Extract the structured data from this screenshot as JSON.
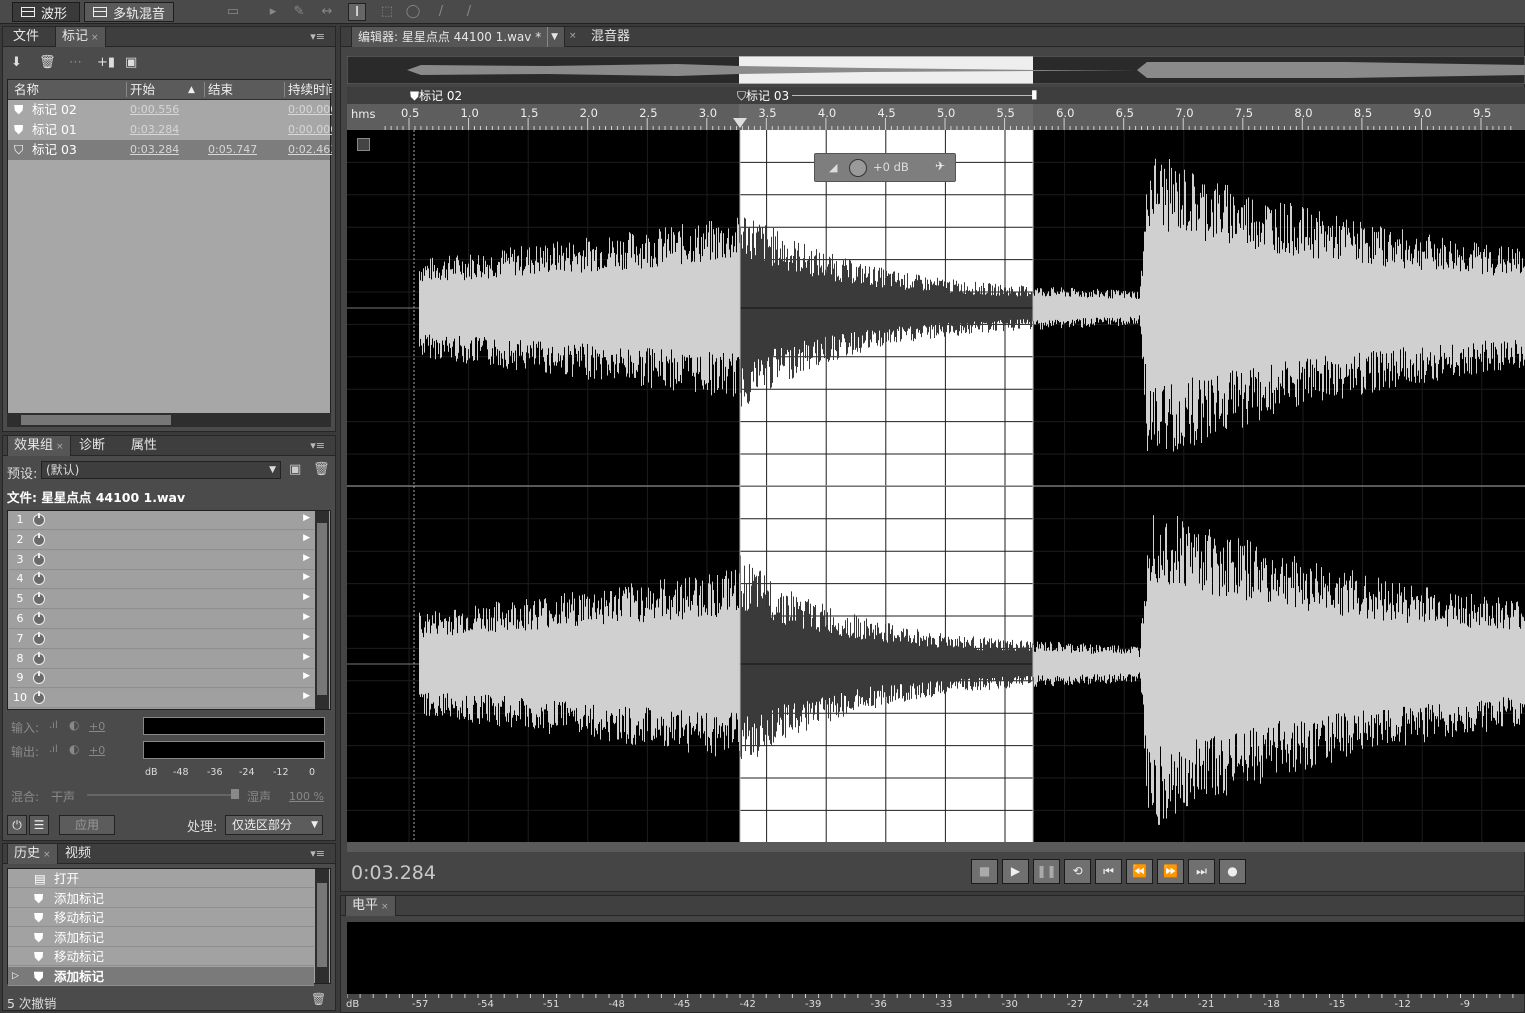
{
  "toolbar": {
    "waveform_label": "波形",
    "multitrack_label": "多轨混音"
  },
  "files_panel": {
    "tab_file": "文件",
    "tab_markers": "标记",
    "columns": [
      "名称",
      "开始",
      "结束",
      "持续时间"
    ],
    "rows": [
      {
        "name": "标记 02",
        "start": "0:00.556",
        "end": "",
        "duration": "0:00.000"
      },
      {
        "name": "标记 01",
        "start": "0:03.284",
        "end": "",
        "duration": "0:00.000"
      },
      {
        "name": "标记 03",
        "start": "0:03.284",
        "end": "0:05.747",
        "duration": "0:02.463"
      }
    ]
  },
  "effects_panel": {
    "tab_effects": "效果组",
    "tab_diag": "诊断",
    "tab_props": "属性",
    "preset_label": "预设:",
    "preset_value": "(默认)",
    "file_label": "文件: 星星点点 44100 1.wav",
    "slots": [
      "1",
      "2",
      "3",
      "4",
      "5",
      "6",
      "7",
      "8",
      "9",
      "10"
    ],
    "input_label": "输入:",
    "output_label": "输出:",
    "gain_in": "+0",
    "gain_out": "+0",
    "meter_ticks": [
      "dB",
      "-48",
      "-36",
      "-24",
      "-12",
      "0"
    ],
    "mix_label": "混合:",
    "dry_label": "干声",
    "wet_label": "湿声",
    "wet_value": "100 %",
    "apply_label": "应用",
    "process_label": "处理:",
    "process_value": "仅选区部分"
  },
  "history_panel": {
    "tab_history": "历史",
    "tab_video": "视频",
    "items": [
      "打开",
      "添加标记",
      "移动标记",
      "添加标记",
      "移动标记",
      "添加标记"
    ],
    "undo_count": "5 次撤销"
  },
  "editor": {
    "tab_editor": "编辑器: 星星点点 44100 1.wav *",
    "tab_mixer": "混音器",
    "marker_02": "标记 02",
    "marker_03": "标记 03",
    "ruler_unit": "hms",
    "ruler_ticks": [
      "0.5",
      "1.0",
      "1.5",
      "2.0",
      "2.5",
      "3.0",
      "3.5",
      "4.0",
      "4.5",
      "5.0",
      "5.5",
      "6.0",
      "6.5",
      "7.0",
      "7.5",
      "8.0",
      "8.5",
      "9.0",
      "9.5"
    ],
    "hud_gain": "+0 dB",
    "time_display": "0:03.284"
  },
  "levels_panel": {
    "tab_levels": "电平",
    "ticks": [
      "dB",
      "-57",
      "-54",
      "-51",
      "-48",
      "-45",
      "-42",
      "-39",
      "-36",
      "-33",
      "-30",
      "-27",
      "-24",
      "-21",
      "-18",
      "-15",
      "-12",
      "-9",
      "-6"
    ]
  },
  "colors": {
    "selection": "#ffffff",
    "wave_unselected": "#d0d0d0",
    "wave_selected": "#3a3a3a",
    "wave_bg": "#000000"
  }
}
